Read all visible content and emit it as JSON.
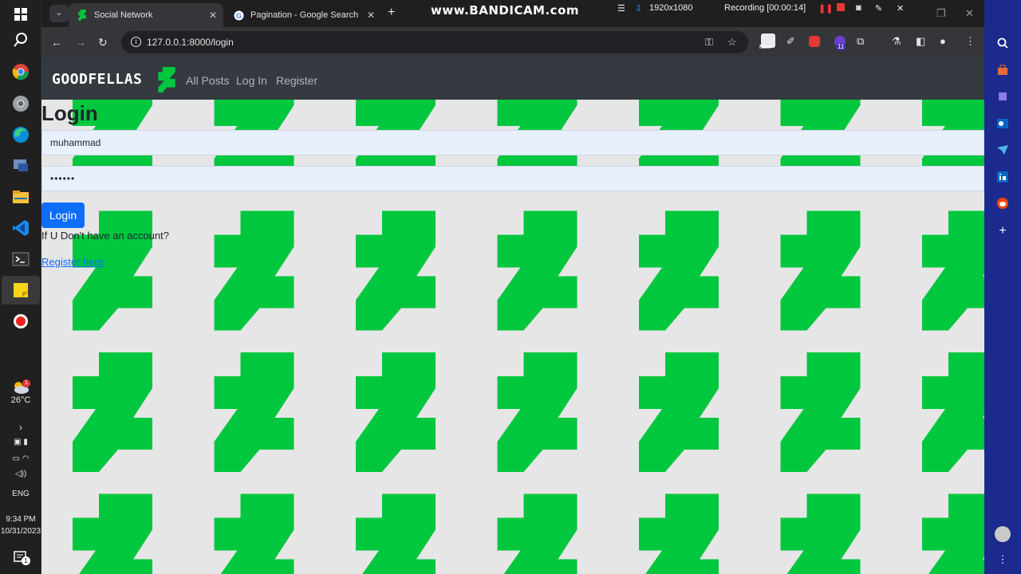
{
  "taskbar": {
    "weather": {
      "temp": "26°C",
      "badge": "1"
    },
    "language": "ENG",
    "time": "9:34 PM",
    "date": "10/31/2023",
    "notification_count": "1"
  },
  "browser": {
    "tabs": [
      {
        "title": "Social Network",
        "active": true
      },
      {
        "title": "Pagination - Google Search",
        "active": false
      }
    ],
    "url": "127.0.0.1:8000/login",
    "extension_badge": "11",
    "new_badge": "New"
  },
  "recorder": {
    "watermark": "www.BANDICAM.com",
    "resolution": "1920x1080",
    "status": "Recording [00:00:14]"
  },
  "site": {
    "brand": "GOODFELLAS",
    "nav": [
      "All Posts",
      "Log In",
      "Register"
    ],
    "accent_color": "#00c73e",
    "login": {
      "title": "Login",
      "username_value": "muhammad",
      "password_value": "••••••",
      "button_label": "Login",
      "help_text": "If U Don't have an account?",
      "register_link": "Register here"
    }
  }
}
